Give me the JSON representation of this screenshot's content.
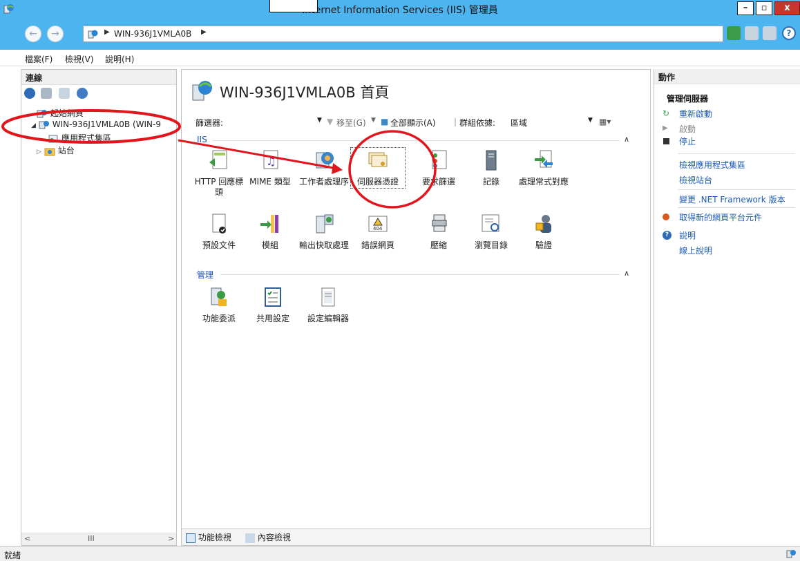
{
  "window": {
    "title": "Internet Information Services (IIS) 管理員",
    "min_label": "–",
    "max_label": "▫",
    "close_label": "x"
  },
  "address": {
    "crumb": "WIN-936J1VMLA0B"
  },
  "menu": {
    "file": "檔案(F)",
    "view": "檢視(V)",
    "help": "說明(H)"
  },
  "connections": {
    "header": "連線",
    "tree": [
      {
        "label": "起始網頁"
      },
      {
        "label": "WIN-936J1VMLA0B (WIN-9"
      },
      {
        "label": "應用程式集區"
      },
      {
        "label": "站台"
      }
    ],
    "scroll_mid": "III"
  },
  "center": {
    "title": "WIN-936J1VMLA0B 首頁",
    "filter_label": "篩選器:",
    "goto_label": "移至(G)",
    "show_all_label": "全部顯示(A)",
    "group_by_label": "群組依據:",
    "group_by_value": "區域",
    "sections": [
      {
        "name": "IIS"
      },
      {
        "name": "管理"
      }
    ],
    "iis_features": [
      {
        "label": "HTTP 回應標頭",
        "icon": "http-response-headers-icon"
      },
      {
        "label": "MIME 類型",
        "icon": "mime-types-icon"
      },
      {
        "label": "工作者處理序",
        "icon": "worker-processes-icon"
      },
      {
        "label": "伺服器憑證",
        "icon": "server-certificates-icon"
      },
      {
        "label": "要求篩選",
        "icon": "request-filtering-icon"
      },
      {
        "label": "記錄",
        "icon": "logging-icon"
      },
      {
        "label": "處理常式對應",
        "icon": "handler-mappings-icon"
      },
      {
        "label": "預設文件",
        "icon": "default-document-icon"
      },
      {
        "label": "模組",
        "icon": "modules-icon"
      },
      {
        "label": "輸出快取處理",
        "icon": "output-caching-icon"
      },
      {
        "label": "錯誤網頁",
        "icon": "error-pages-icon"
      },
      {
        "label": "壓縮",
        "icon": "compression-icon"
      },
      {
        "label": "瀏覽目錄",
        "icon": "directory-browsing-icon"
      },
      {
        "label": "驗證",
        "icon": "authentication-icon"
      }
    ],
    "mgmt_features": [
      {
        "label": "功能委派",
        "icon": "feature-delegation-icon"
      },
      {
        "label": "共用設定",
        "icon": "shared-configuration-icon"
      },
      {
        "label": "設定編輯器",
        "icon": "configuration-editor-icon"
      }
    ],
    "features_view": "功能檢視",
    "content_view": "內容檢視"
  },
  "actions": {
    "header": "動作",
    "manage_server": "管理伺服器",
    "restart": "重新啟動",
    "start": "啟動",
    "stop": "停止",
    "view_app_pools": "檢視應用程式集區",
    "view_sites": "檢視站台",
    "change_framework": "變更 .NET Framework 版本",
    "get_components": "取得新的網頁平台元件",
    "help": "說明",
    "online_help": "線上說明"
  },
  "status": {
    "text": "就緒"
  },
  "colors": {
    "titlebar": "#4cb5f0",
    "annotation_red": "#e0161c",
    "link_blue": "#1c5ab8"
  }
}
